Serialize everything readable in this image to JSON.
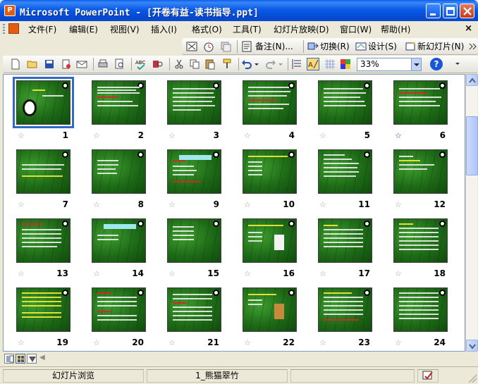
{
  "window": {
    "title": "Microsoft PowerPoint - [开卷有益-读书指导.ppt]",
    "app_icon": "P"
  },
  "menu": {
    "items": [
      "文件(F)",
      "编辑(E)",
      "视图(V)",
      "插入(I)",
      "格式(O)",
      "工具(T)",
      "幻灯片放映(D)",
      "窗口(W)",
      "帮助(H)"
    ],
    "close_glyph": "×"
  },
  "toolbar_top": {
    "notes_label": "备注(N)...",
    "transition_label": "切换(R)",
    "design_label": "设计(S)",
    "new_slide_label": "新幻灯片(N)"
  },
  "toolbar_main": {
    "zoom": "33%",
    "help_glyph": "?"
  },
  "slides": [
    {
      "num": "1",
      "starred": false,
      "selected": true
    },
    {
      "num": "2",
      "starred": false
    },
    {
      "num": "3",
      "starred": false
    },
    {
      "num": "4",
      "starred": false
    },
    {
      "num": "5",
      "starred": false
    },
    {
      "num": "6",
      "starred": true
    },
    {
      "num": "7",
      "starred": false
    },
    {
      "num": "8",
      "starred": false
    },
    {
      "num": "9",
      "starred": false
    },
    {
      "num": "10",
      "starred": false
    },
    {
      "num": "11",
      "starred": false
    },
    {
      "num": "12",
      "starred": false
    },
    {
      "num": "13",
      "starred": false
    },
    {
      "num": "14",
      "starred": false
    },
    {
      "num": "15",
      "starred": false
    },
    {
      "num": "16",
      "starred": false
    },
    {
      "num": "17",
      "starred": false
    },
    {
      "num": "18",
      "starred": false
    },
    {
      "num": "19",
      "starred": false
    },
    {
      "num": "20",
      "starred": false
    },
    {
      "num": "21",
      "starred": false
    },
    {
      "num": "22",
      "starred": false
    },
    {
      "num": "23",
      "starred": false
    },
    {
      "num": "24",
      "starred": false
    }
  ],
  "star_glyph": "☆",
  "status": {
    "view": "幻灯片浏览",
    "design": "1_熊猫翠竹"
  },
  "colors": {
    "titlebar": "#0A5BE8",
    "slide_bg": "#1E6A17",
    "selection": "#316AC5"
  }
}
